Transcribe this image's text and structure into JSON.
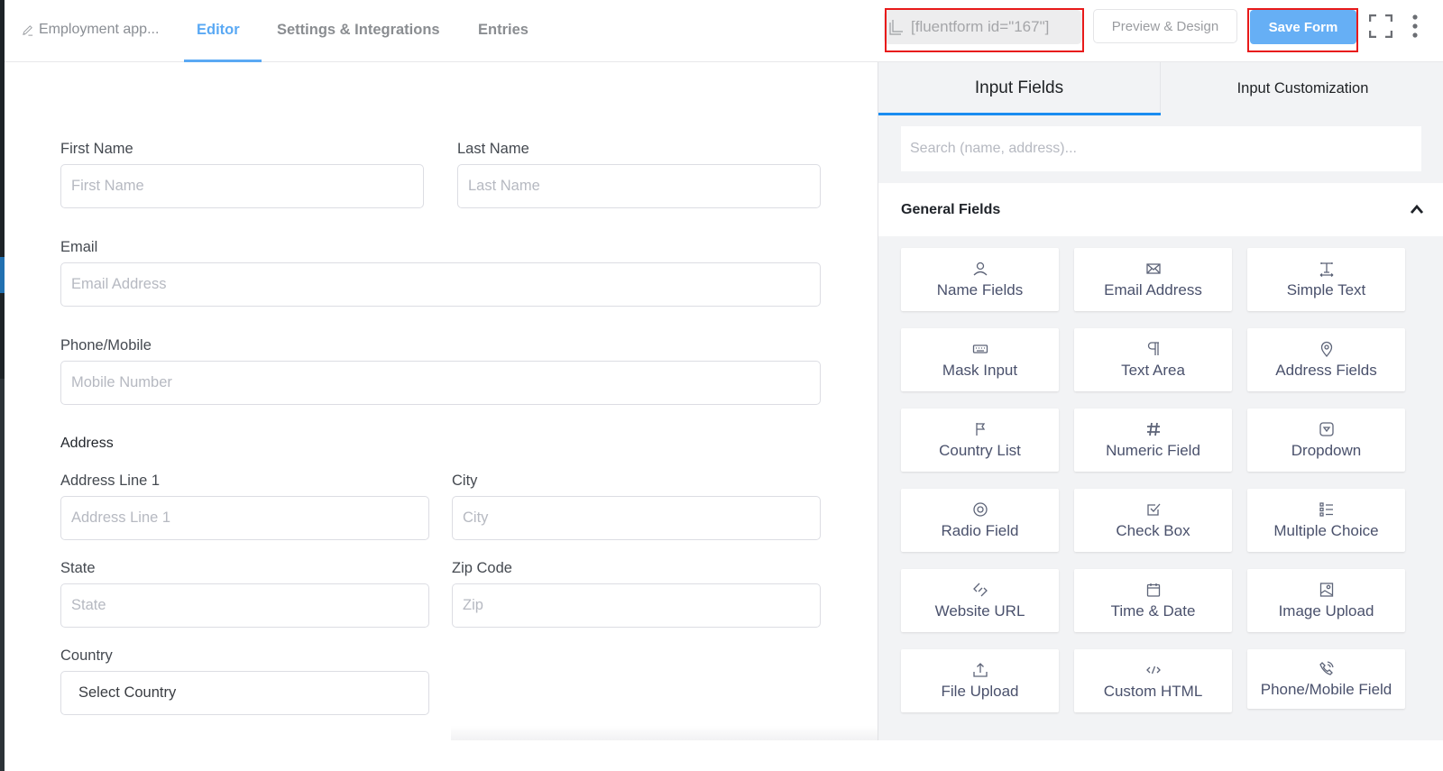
{
  "header": {
    "form_title": "Employment app...",
    "tabs": [
      {
        "label": "Editor",
        "active": true
      },
      {
        "label": "Settings & Integrations",
        "active": false
      },
      {
        "label": "Entries",
        "active": false
      }
    ],
    "shortcode": "[fluentform id=\"167\"]",
    "preview_label": "Preview & Design",
    "save_label": "Save Form",
    "accent_color": "#5aa9f4",
    "highlight_color": "#e81a1a"
  },
  "form": {
    "first_name": {
      "label": "First Name",
      "placeholder": "First Name"
    },
    "last_name": {
      "label": "Last Name",
      "placeholder": "Last Name"
    },
    "email": {
      "label": "Email",
      "placeholder": "Email Address"
    },
    "phone": {
      "label": "Phone/Mobile",
      "placeholder": "Mobile Number"
    },
    "address_section": "Address",
    "address_line1": {
      "label": "Address Line 1",
      "placeholder": "Address Line 1"
    },
    "city": {
      "label": "City",
      "placeholder": "City"
    },
    "state": {
      "label": "State",
      "placeholder": "State"
    },
    "zip": {
      "label": "Zip Code",
      "placeholder": "Zip"
    },
    "country": {
      "label": "Country",
      "value": "Select Country"
    }
  },
  "sidebar": {
    "tabs": [
      {
        "label": "Input Fields",
        "active": true
      },
      {
        "label": "Input Customization",
        "active": false
      }
    ],
    "search_placeholder": "Search (name, address)...",
    "section_title": "General Fields",
    "fields": [
      {
        "label": "Name Fields",
        "icon": "user-icon"
      },
      {
        "label": "Email Address",
        "icon": "envelope-icon"
      },
      {
        "label": "Simple Text",
        "icon": "text-icon"
      },
      {
        "label": "Mask Input",
        "icon": "keyboard-icon"
      },
      {
        "label": "Text Area",
        "icon": "paragraph-icon"
      },
      {
        "label": "Address Fields",
        "icon": "map-pin-icon"
      },
      {
        "label": "Country List",
        "icon": "flag-icon"
      },
      {
        "label": "Numeric Field",
        "icon": "hash-icon"
      },
      {
        "label": "Dropdown",
        "icon": "dropdown-icon"
      },
      {
        "label": "Radio Field",
        "icon": "radio-icon"
      },
      {
        "label": "Check Box",
        "icon": "checkbox-icon"
      },
      {
        "label": "Multiple Choice",
        "icon": "list-icon"
      },
      {
        "label": "Website URL",
        "icon": "link-icon"
      },
      {
        "label": "Time & Date",
        "icon": "calendar-icon"
      },
      {
        "label": "Image Upload",
        "icon": "image-icon"
      },
      {
        "label": "File Upload",
        "icon": "upload-icon"
      },
      {
        "label": "Custom HTML",
        "icon": "code-icon"
      },
      {
        "label": "Phone/Mobile Field",
        "icon": "phone-icon"
      }
    ]
  }
}
